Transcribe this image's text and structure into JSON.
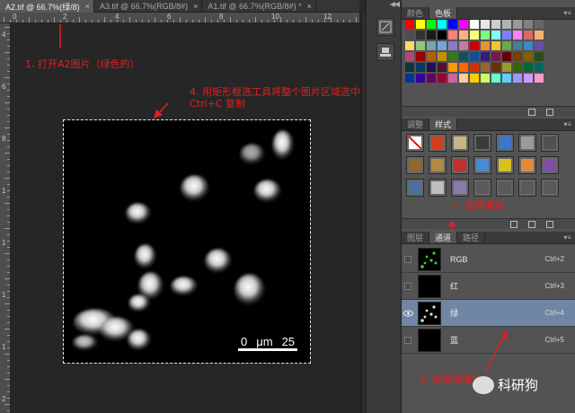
{
  "document_tabs": [
    {
      "label": "A2.tif @ 66.7%(绿/8)",
      "active": true
    },
    {
      "label": "A3.tif @ 66.7%(RGB/8#)",
      "active": false
    },
    {
      "label": "A1.tif @ 66.7%(RGB/8#) *",
      "active": false
    }
  ],
  "tab_close_glyph": "×",
  "ruler_top_labels": [
    "0",
    "2",
    "4",
    "6",
    "8",
    "10",
    "12"
  ],
  "ruler_left_labels": [
    "4",
    "6",
    "8",
    "1",
    "1",
    "1",
    "1",
    "2"
  ],
  "annotations": {
    "step1": "1. 打开A2图片（绿色的）",
    "step4": "4. 用矩形框选工具将整个图片区域选中，然后\nCtrl+C 复制",
    "step2": "2. 选择通道",
    "step3": "3. 选择绿通道"
  },
  "scale_bar": {
    "zero": "0",
    "unit": "μm",
    "value": "25"
  },
  "swatches_panel": {
    "tabs": [
      "颜色",
      "色板"
    ],
    "active_tab": "色板",
    "colors": [
      "#ff0000",
      "#ffff00",
      "#00ff00",
      "#00ffff",
      "#0000ff",
      "#ff00ff",
      "#ffffff",
      "#e6e6e6",
      "#cccccc",
      "#b3b3b3",
      "#999999",
      "#808080",
      "#666666",
      "#4d4d4d",
      "#333333",
      "#1a1a1a",
      "#000000",
      "#ff7f7f",
      "#ffb27f",
      "#ffff7f",
      "#7fff7f",
      "#7fffff",
      "#7f7fff",
      "#ff7fff",
      "#e06666",
      "#f6b26b",
      "#ffd966",
      "#93c47d",
      "#76a5af",
      "#6fa8dc",
      "#8e7cc3",
      "#c27ba0",
      "#cc0000",
      "#e69138",
      "#f1c232",
      "#6aa84f",
      "#45818e",
      "#3d85c6",
      "#674ea7",
      "#a64d79",
      "#990000",
      "#b45f06",
      "#bf9000",
      "#38761d",
      "#134f5c",
      "#0b5394",
      "#351c75",
      "#741b47",
      "#660000",
      "#783f04",
      "#7f6000",
      "#274e13",
      "#0c343d",
      "#073763",
      "#20124d",
      "#4c1130",
      "#ff9900",
      "#ff6600",
      "#cc3300",
      "#996633",
      "#663300",
      "#999933",
      "#336600",
      "#006633",
      "#006666",
      "#003399",
      "#330099",
      "#660066",
      "#990033",
      "#cc6699",
      "#ffcc99",
      "#ffcc00",
      "#ccff66",
      "#66ffcc",
      "#66ccff",
      "#9999ff",
      "#cc99ff",
      "#ff99cc"
    ]
  },
  "styles_panel": {
    "tabs": [
      "调整",
      "样式"
    ],
    "active_tab": "样式",
    "cells": [
      "#ffffff",
      "#d04020",
      "#c9b58a",
      "#3a3a3a",
      "#3b78c9",
      "#9a9a9a",
      "#505050",
      "#8a6a30",
      "#b08a40",
      "#c03030",
      "#4a8ad0",
      "#d8c020",
      "#e08a40",
      "#8050a0",
      "#4a70a0",
      "#bfbfbf",
      "#8a7aaa",
      "#5a5a5a",
      "#5a5a5a",
      "#5a5a5a",
      "#5a5a5a"
    ]
  },
  "channels_panel": {
    "tabs": [
      "图层",
      "通道",
      "路径"
    ],
    "active_tab": "通道",
    "channels": [
      {
        "name": "RGB",
        "shortcut": "Ctrl+2",
        "selected": false,
        "visible": false
      },
      {
        "name": "红",
        "shortcut": "Ctrl+3",
        "selected": false,
        "visible": false
      },
      {
        "name": "绿",
        "shortcut": "Ctrl+4",
        "selected": true,
        "visible": true
      },
      {
        "name": "蓝",
        "shortcut": "Ctrl+5",
        "selected": false,
        "visible": false
      }
    ]
  },
  "panel_menu_glyph": "▾≡",
  "collapse_glyph": "◀◀",
  "watermark": "科研狗",
  "colors": {
    "annotation": "#e02020",
    "selected_row": "#6f86a4",
    "active_tab": "#585858"
  }
}
